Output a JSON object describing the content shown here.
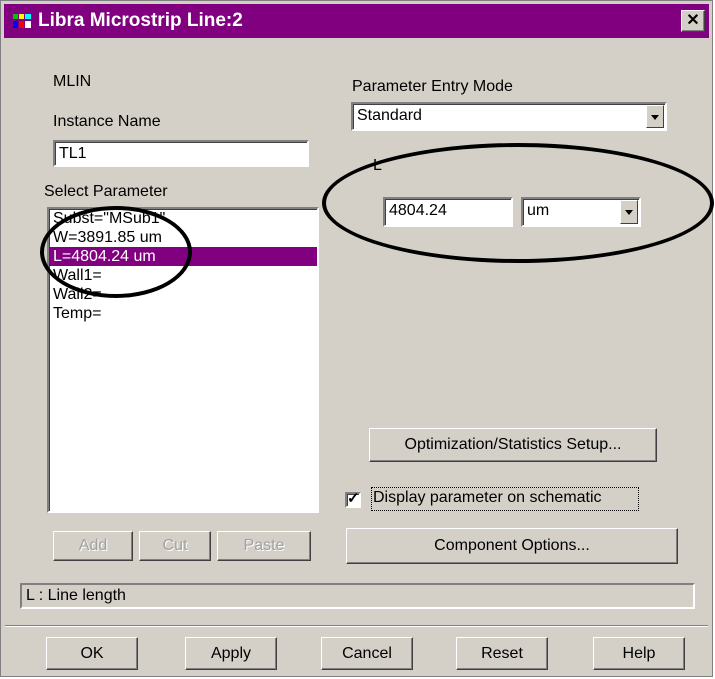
{
  "window": {
    "title": "Libra Microstrip Line:2",
    "close_label": "✕"
  },
  "component": {
    "type": "MLIN"
  },
  "instance": {
    "label": "Instance Name",
    "value": "TL1"
  },
  "parameters": {
    "label": "Select Parameter",
    "items": [
      "Subst=\"MSub1\"",
      "W=3891.85 um",
      "L=4804.24 um",
      "Wall1=",
      "Wall2=",
      "Temp="
    ],
    "selected_index": 2
  },
  "entry_mode": {
    "label": "Parameter Entry Mode",
    "value": "Standard"
  },
  "param_edit": {
    "name": "L",
    "value": "4804.24",
    "unit": "um"
  },
  "buttons": {
    "optimization": "Optimization/Statistics Setup...",
    "component_options": "Component Options...",
    "add": "Add",
    "cut": "Cut",
    "paste": "Paste",
    "ok": "OK",
    "apply": "Apply",
    "cancel": "Cancel",
    "reset": "Reset",
    "help": "Help"
  },
  "display_on_schematic": {
    "label": "Display parameter on schematic",
    "checked": true
  },
  "status": {
    "text": "L : Line length"
  },
  "colors": {
    "titlebar": "#800080",
    "selection": "#800080",
    "dialog_bg": "#d4d0c8"
  },
  "icons": {
    "app": "libra-app-icon",
    "close": "close-icon",
    "dropdown": "chevron-down-icon",
    "check": "checkmark-icon"
  }
}
